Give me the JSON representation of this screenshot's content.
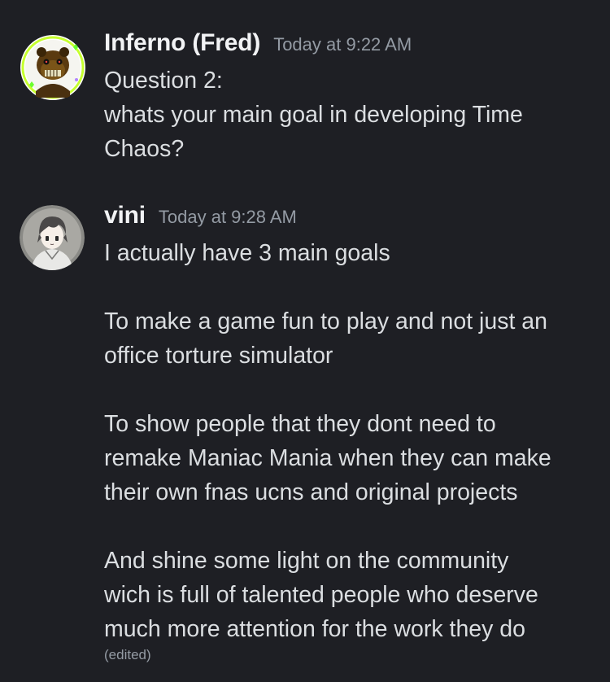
{
  "messages": [
    {
      "username": "Inferno (Fred)",
      "timestamp": "Today at 9:22 AM",
      "lines": [
        "Question 2:",
        "whats your main goal in developing Time",
        "Chaos?"
      ]
    },
    {
      "username": "vini",
      "timestamp": "Today at 9:28 AM",
      "lines": [
        "I actually have 3 main goals",
        "",
        "To make a game fun to play and not just an",
        "office torture simulator",
        "",
        "To show people that they dont need to",
        "remake Maniac Mania when they can make",
        "their own fnas ucns and original projects",
        "",
        "And shine some light on the community",
        "wich is full of talented people who deserve",
        "much more attention for the work they do"
      ],
      "edited_label": "(edited)"
    }
  ],
  "icons": {
    "avatar_1": "animatronic-bear-avatar",
    "avatar_2": "anime-boy-avatar"
  },
  "colors": {
    "background": "#1e1f24",
    "username": "#f2f3f5",
    "timestamp": "#949ba4",
    "text": "#dbdee1",
    "avatar_ring": "#d4ff3a"
  }
}
